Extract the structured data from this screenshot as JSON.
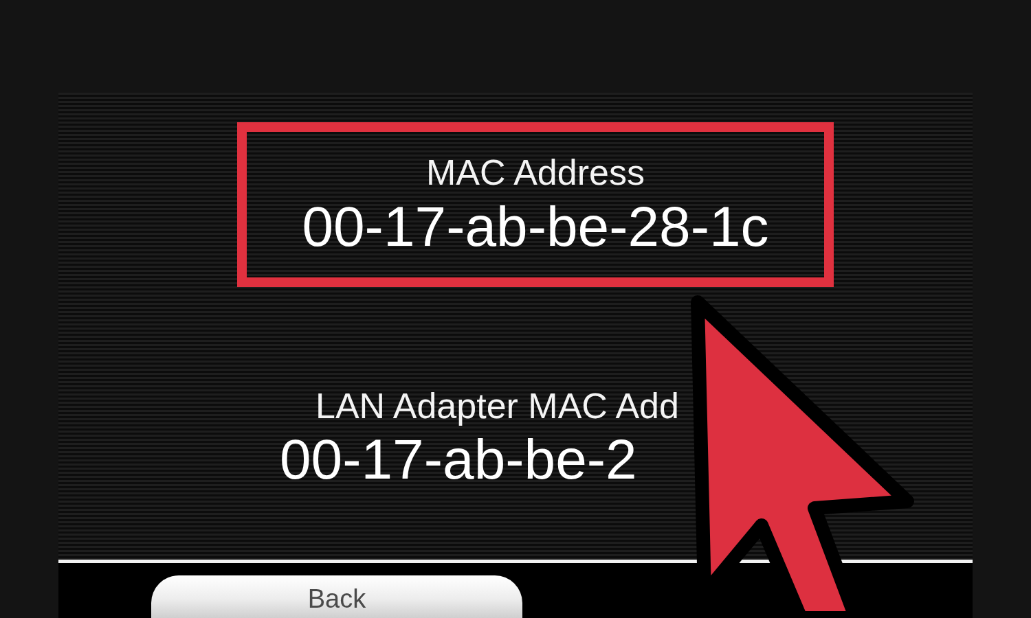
{
  "highlight": {
    "label": "MAC Address",
    "value": "00-17-ab-be-28-1c"
  },
  "lan": {
    "label": "LAN Adapter MAC Add",
    "value": "00-17-ab-be-2"
  },
  "back_button": {
    "label": "Back"
  }
}
